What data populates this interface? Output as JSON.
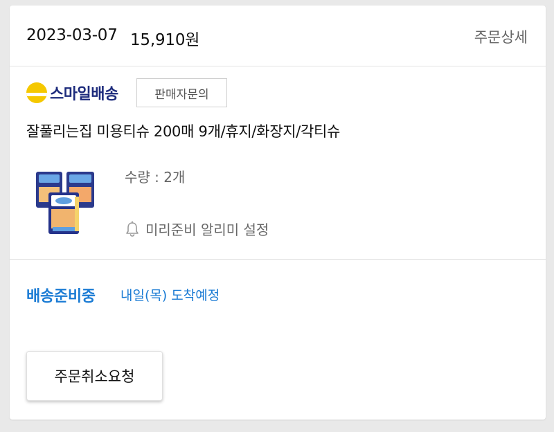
{
  "order": {
    "date": "2023-03-07",
    "amount": "15,910원",
    "detail_link": "주문상세"
  },
  "seller": {
    "badge_text": "스마일배송",
    "contact_button": "판매자문의"
  },
  "product": {
    "name": "잘풀리는집 미용티슈 200매 9개/휴지/화장지/각티슈",
    "quantity": "수량 : 2개",
    "notify_label": "미리준비 알리미 설정"
  },
  "shipping": {
    "status": "배송준비중",
    "arrival": "내일(목) 도착예정"
  },
  "actions": {
    "cancel_request": "주문취소요청"
  },
  "icons": {
    "smile": "smile-delivery-icon",
    "bell": "bell-icon"
  },
  "colors": {
    "accent_blue": "#1a7bd4",
    "smile_yellow": "#f5c800",
    "smile_navy": "#1d2b7c"
  }
}
